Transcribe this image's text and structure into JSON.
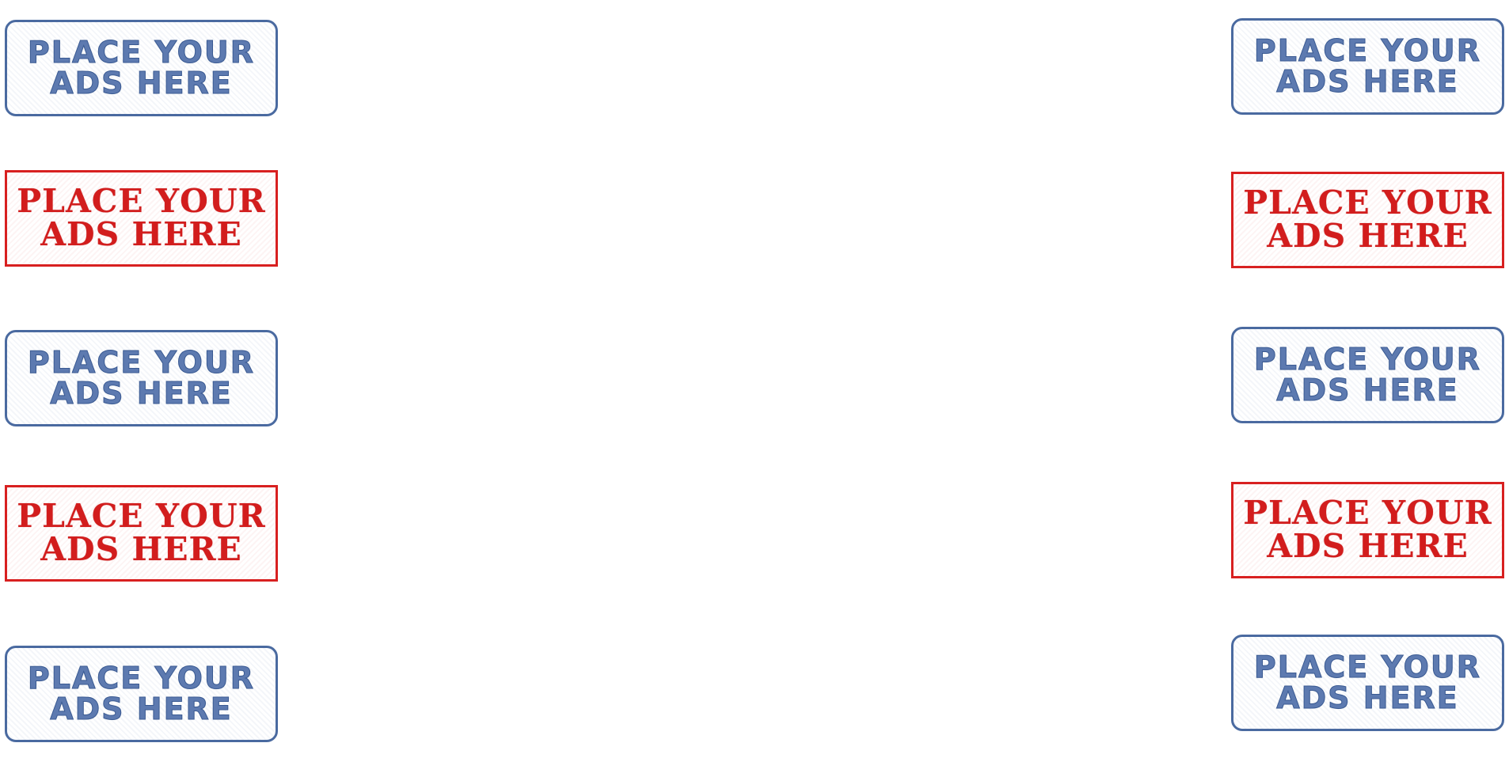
{
  "stamps": {
    "left": [
      {
        "line1": "PLACE YOUR",
        "line2": "ADS HERE",
        "style": "blue"
      },
      {
        "line1": "PLACE YOUR",
        "line2": "ADS HERE",
        "style": "red"
      },
      {
        "line1": "PLACE YOUR",
        "line2": "ADS HERE",
        "style": "blue"
      },
      {
        "line1": "PLACE YOUR",
        "line2": "ADS HERE",
        "style": "red"
      },
      {
        "line1": "PLACE YOUR",
        "line2": "ADS HERE",
        "style": "blue"
      }
    ],
    "right": [
      {
        "line1": "PLACE YOUR",
        "line2": "ADS HERE",
        "style": "blue"
      },
      {
        "line1": "PLACE YOUR",
        "line2": "ADS HERE",
        "style": "red"
      },
      {
        "line1": "PLACE YOUR",
        "line2": "ADS HERE",
        "style": "blue"
      },
      {
        "line1": "PLACE YOUR",
        "line2": "ADS HERE",
        "style": "red"
      },
      {
        "line1": "PLACE YOUR",
        "line2": "ADS HERE",
        "style": "blue"
      }
    ]
  },
  "colors": {
    "blue_stamp": "#4a6aa0",
    "red_stamp": "#d82020",
    "background": "#ffffff"
  }
}
